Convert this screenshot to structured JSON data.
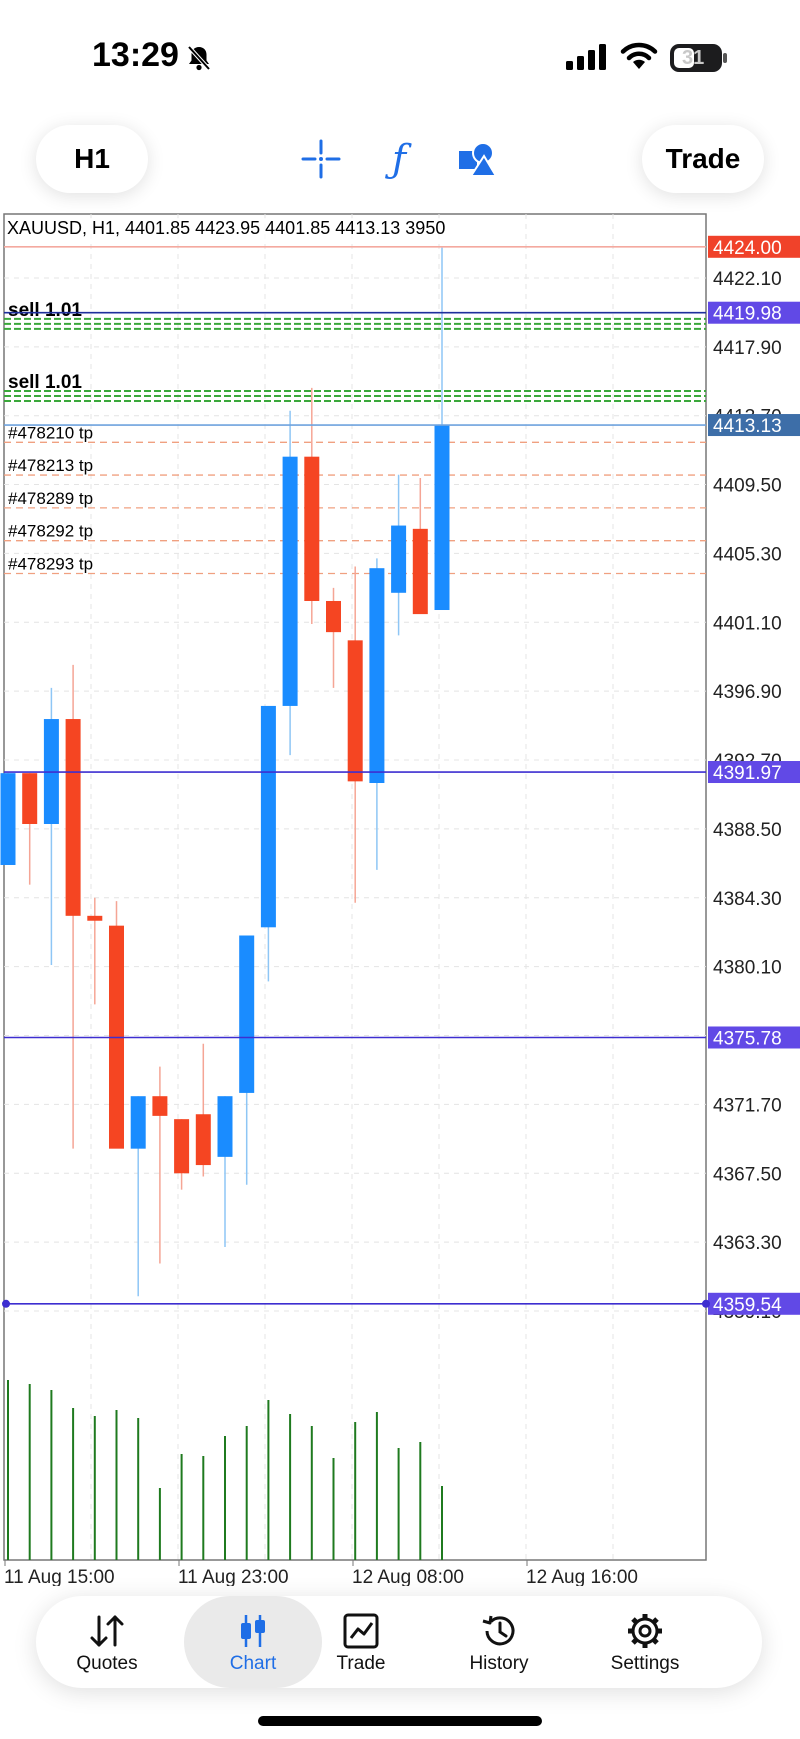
{
  "status_bar": {
    "time": "13:29",
    "battery": "31"
  },
  "toolbar": {
    "timeframe": "H1",
    "trade_label": "Trade",
    "icons": [
      "crosshair-icon",
      "indicators-f-icon",
      "objects-shapes-icon"
    ]
  },
  "chart_info": "XAUUSD, H1, 4401.85 4423.95 4401.85 4413.13 3950",
  "chart_data": {
    "type": "candlestick",
    "symbol": "XAUUSD",
    "timeframe": "H1",
    "ohlc_header": {
      "open": 4401.85,
      "high": 4423.95,
      "low": 4401.85,
      "close": 4413.13,
      "volume": 3950
    },
    "price_ticks": [
      "4422.10",
      "4417.90",
      "4413.70",
      "4409.50",
      "4405.30",
      "4401.10",
      "4396.90",
      "4392.70",
      "4388.50",
      "4384.30",
      "4380.10",
      "4375.90",
      "4371.70",
      "4367.50",
      "4363.30",
      "4359.10"
    ],
    "x_labels": [
      "11 Aug 15:00",
      "11 Aug 23:00",
      "12 Aug 08:00",
      "12 Aug 16:00"
    ],
    "ylim": [
      4356.6,
      4426.0
    ],
    "candles": [
      {
        "o": 4386.3,
        "h": 4391.9,
        "l": 4386.3,
        "c": 4391.9
      },
      {
        "o": 4391.9,
        "h": 4391.9,
        "l": 4385.1,
        "c": 4388.8
      },
      {
        "o": 4388.8,
        "h": 4397.1,
        "l": 4380.2,
        "c": 4395.2
      },
      {
        "o": 4395.2,
        "h": 4398.5,
        "l": 4369.0,
        "c": 4383.2
      },
      {
        "o": 4383.2,
        "h": 4384.3,
        "l": 4377.8,
        "c": 4382.9
      },
      {
        "o": 4382.6,
        "h": 4384.1,
        "l": 4370.0,
        "c": 4369.0
      },
      {
        "o": 4369.0,
        "h": 4372.2,
        "l": 4360.0,
        "c": 4372.2
      },
      {
        "o": 4372.2,
        "h": 4374.0,
        "l": 4362.0,
        "c": 4371.0
      },
      {
        "o": 4370.8,
        "h": 4370.8,
        "l": 4366.5,
        "c": 4367.5
      },
      {
        "o": 4371.1,
        "h": 4375.4,
        "l": 4367.3,
        "c": 4368.0
      },
      {
        "o": 4368.5,
        "h": 4372.2,
        "l": 4363.0,
        "c": 4372.2
      },
      {
        "o": 4372.4,
        "h": 4378.7,
        "l": 4366.8,
        "c": 4382.0
      },
      {
        "o": 4382.5,
        "h": 4385.0,
        "l": 4379.2,
        "c": 4396.0
      },
      {
        "o": 4396.0,
        "h": 4414.0,
        "l": 4393.0,
        "c": 4411.2
      },
      {
        "o": 4411.2,
        "h": 4415.4,
        "l": 4401.0,
        "c": 4402.4
      },
      {
        "o": 4402.4,
        "h": 4403.2,
        "l": 4397.1,
        "c": 4400.5
      },
      {
        "o": 4400.0,
        "h": 4404.5,
        "l": 4384.0,
        "c": 4391.4
      },
      {
        "o": 4391.3,
        "h": 4405.0,
        "l": 4386.0,
        "c": 4404.4
      },
      {
        "o": 4402.9,
        "h": 4410.1,
        "l": 4400.3,
        "c": 4407.0
      },
      {
        "o": 4406.8,
        "h": 4409.9,
        "l": 4401.8,
        "c": 4401.6
      },
      {
        "o": 4401.85,
        "h": 4423.95,
        "l": 4401.85,
        "c": 4413.13
      }
    ],
    "volumes": [
      0.9,
      0.88,
      0.85,
      0.76,
      0.72,
      0.75,
      0.71,
      0.36,
      0.53,
      0.52,
      0.62,
      0.67,
      0.8,
      0.73,
      0.67,
      0.51,
      0.69,
      0.74,
      0.56,
      0.59,
      0.37
    ],
    "price_labels": [
      {
        "price": 4424.0,
        "text": "4424.00",
        "color": "#f0422a",
        "line": "#f4a99f"
      },
      {
        "price": 4419.98,
        "text": "4419.98",
        "color": "#6149e6",
        "line": "#1e2f9c"
      },
      {
        "price": 4413.13,
        "text": "4413.13",
        "color": "#3d6ea8",
        "line": "#6fa3de"
      },
      {
        "price": 4391.97,
        "text": "4391.97",
        "color": "#6149e6",
        "line": "#3d2ed0"
      },
      {
        "price": 4375.78,
        "text": "4375.78",
        "color": "#6149e6",
        "line": "#3d2ed0"
      },
      {
        "price": 4359.54,
        "text": "4359.54",
        "color": "#6149e6",
        "line": "#3d2ed0"
      }
    ],
    "sell_levels": [
      {
        "price": 4419.3,
        "text": "sell 1.01"
      },
      {
        "price": 4414.9,
        "text": "sell 1.01"
      }
    ],
    "tp_orders": [
      {
        "price": 4412.2,
        "text": "#478210 tp"
      },
      {
        "price": 4410.2,
        "text": "#478213 tp"
      },
      {
        "price": 4408.2,
        "text": "#478289 tp"
      },
      {
        "price": 4406.2,
        "text": "#478292 tp"
      },
      {
        "price": 4404.2,
        "text": "#478293 tp"
      }
    ],
    "colors": {
      "bull": "#1a8cff",
      "bear": "#f54522",
      "volume": "#1f7a1f",
      "grid": "#e4e4e4"
    },
    "grid": true
  },
  "nav": {
    "items": [
      {
        "label": "Quotes",
        "icon": "quotes-arrows-icon"
      },
      {
        "label": "Chart",
        "icon": "chart-candles-icon"
      },
      {
        "label": "Trade",
        "icon": "trade-chart-icon"
      },
      {
        "label": "History",
        "icon": "history-clock-icon"
      },
      {
        "label": "Settings",
        "icon": "settings-gear-icon"
      }
    ],
    "active": "Chart"
  }
}
